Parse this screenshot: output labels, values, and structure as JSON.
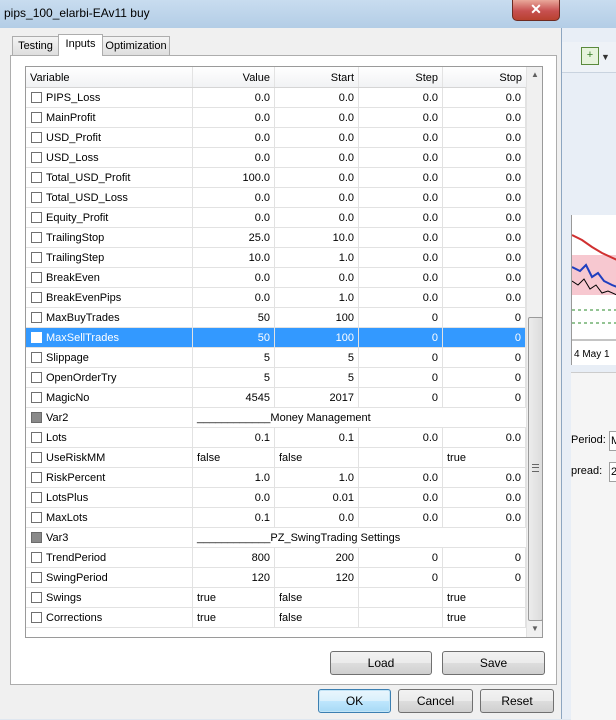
{
  "window": {
    "title": "pips_100_elarbi-EAv11 buy",
    "close_label": "✕"
  },
  "tabs": [
    {
      "label": "Testing"
    },
    {
      "label": "Inputs"
    },
    {
      "label": "Optimization"
    }
  ],
  "grid": {
    "headers": {
      "variable": "Variable",
      "value": "Value",
      "start": "Start",
      "step": "Step",
      "stop": "Stop"
    },
    "rows": [
      {
        "name": "PIPS_Loss",
        "value": "0.0",
        "start": "0.0",
        "step": "0.0",
        "stop": "0.0"
      },
      {
        "name": "MainProfit",
        "value": "0.0",
        "start": "0.0",
        "step": "0.0",
        "stop": "0.0"
      },
      {
        "name": "USD_Profit",
        "value": "0.0",
        "start": "0.0",
        "step": "0.0",
        "stop": "0.0"
      },
      {
        "name": "USD_Loss",
        "value": "0.0",
        "start": "0.0",
        "step": "0.0",
        "stop": "0.0"
      },
      {
        "name": "Total_USD_Profit",
        "value": "100.0",
        "start": "0.0",
        "step": "0.0",
        "stop": "0.0"
      },
      {
        "name": "Total_USD_Loss",
        "value": "0.0",
        "start": "0.0",
        "step": "0.0",
        "stop": "0.0"
      },
      {
        "name": "Equity_Profit",
        "value": "0.0",
        "start": "0.0",
        "step": "0.0",
        "stop": "0.0"
      },
      {
        "name": "TrailingStop",
        "value": "25.0",
        "start": "10.0",
        "step": "0.0",
        "stop": "0.0"
      },
      {
        "name": "TrailingStep",
        "value": "10.0",
        "start": "1.0",
        "step": "0.0",
        "stop": "0.0"
      },
      {
        "name": "BreakEven",
        "value": "0.0",
        "start": "0.0",
        "step": "0.0",
        "stop": "0.0"
      },
      {
        "name": "BreakEvenPips",
        "value": "0.0",
        "start": "1.0",
        "step": "0.0",
        "stop": "0.0"
      },
      {
        "name": "MaxBuyTrades",
        "value": "50",
        "start": "100",
        "step": "0",
        "stop": "0"
      },
      {
        "name": "MaxSellTrades",
        "value": "50",
        "start": "100",
        "step": "0",
        "stop": "0",
        "selected": true
      },
      {
        "name": "Slippage",
        "value": "5",
        "start": "5",
        "step": "0",
        "stop": "0"
      },
      {
        "name": "OpenOrderTry",
        "value": "5",
        "start": "5",
        "step": "0",
        "stop": "0"
      },
      {
        "name": "MagicNo",
        "value": "4545",
        "start": "2017",
        "step": "0",
        "stop": "0"
      },
      {
        "name": "Var2",
        "text": "____________Money Management",
        "grey": true
      },
      {
        "name": "Lots",
        "value": "0.1",
        "start": "0.1",
        "step": "0.0",
        "stop": "0.0"
      },
      {
        "name": "UseRiskMM",
        "value": "false",
        "start": "false",
        "step": "",
        "stop": "true",
        "textual": true
      },
      {
        "name": "RiskPercent",
        "value": "1.0",
        "start": "1.0",
        "step": "0.0",
        "stop": "0.0"
      },
      {
        "name": "LotsPlus",
        "value": "0.0",
        "start": "0.01",
        "step": "0.0",
        "stop": "0.0"
      },
      {
        "name": "MaxLots",
        "value": "0.1",
        "start": "0.0",
        "step": "0.0",
        "stop": "0.0"
      },
      {
        "name": "Var3",
        "text": "____________PZ_SwingTrading Settings",
        "grey": true
      },
      {
        "name": "TrendPeriod",
        "value": "800",
        "start": "200",
        "step": "0",
        "stop": "0"
      },
      {
        "name": "SwingPeriod",
        "value": "120",
        "start": "120",
        "step": "0",
        "stop": "0"
      },
      {
        "name": "Swings",
        "value": "true",
        "start": "false",
        "step": "",
        "stop": "true",
        "textual": true
      },
      {
        "name": "Corrections",
        "value": "true",
        "start": "false",
        "step": "",
        "stop": "true",
        "textual": true
      }
    ]
  },
  "buttons": {
    "load": "Load",
    "save": "Save",
    "ok": "OK",
    "cancel": "Cancel",
    "reset": "Reset"
  },
  "background_app": {
    "chart_date_label": "4 May 1",
    "period_label": "Period:",
    "period_value": "M",
    "spread_label": "pread:",
    "spread_value": "2",
    "toolbar_icon": "new-chart-icon"
  },
  "colors": {
    "selection": "#3399ff",
    "title_bar": "#b9d1ea",
    "close_button": "#c75050"
  }
}
